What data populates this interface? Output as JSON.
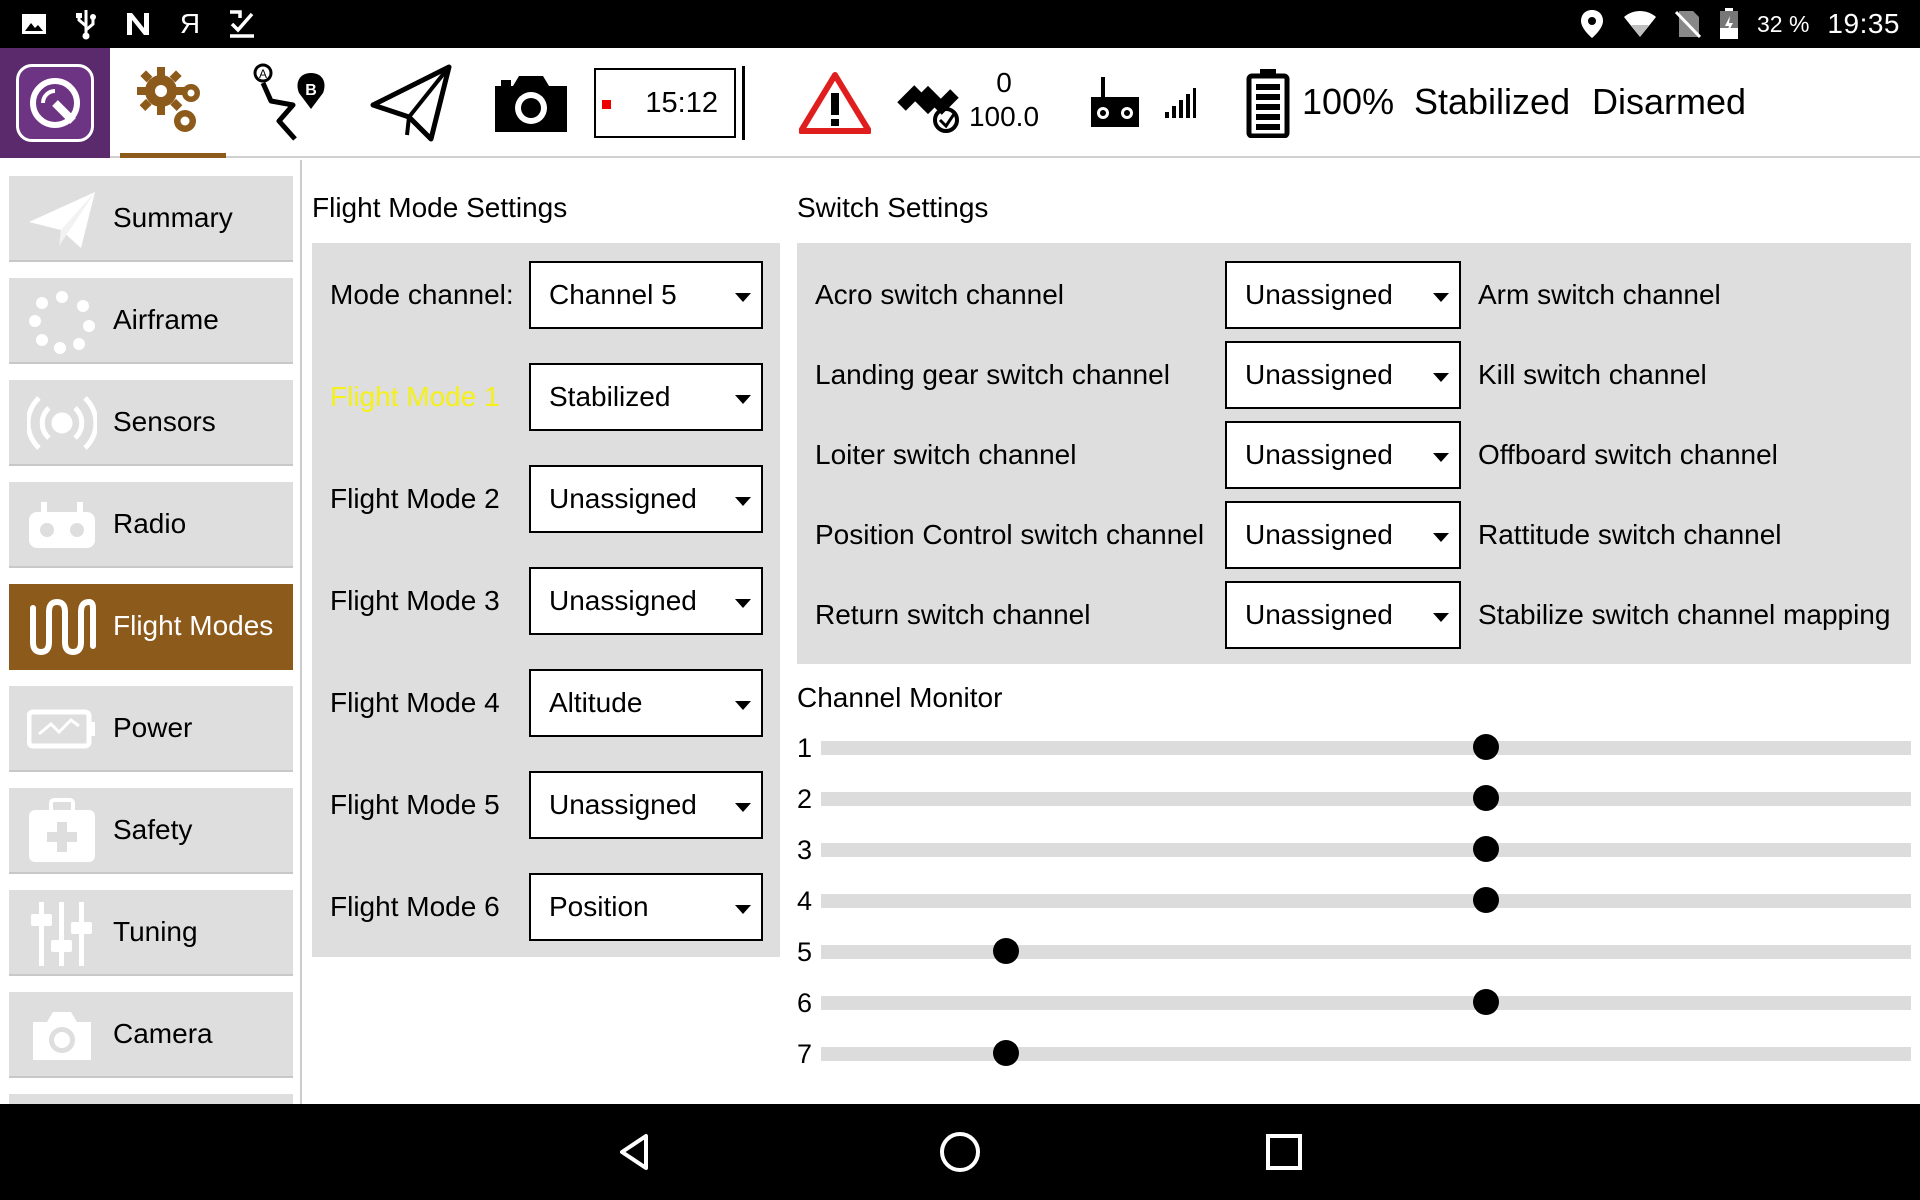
{
  "status_bar": {
    "left_icons": [
      "gallery-icon",
      "usb-icon",
      "nfc-icon",
      "yandex-icon",
      "download-done-icon"
    ],
    "right_icons": [
      "location-icon",
      "wifi-icon",
      "no-sim-icon",
      "battery-charging-icon"
    ],
    "battery_percent": "32 %",
    "time": "19:35"
  },
  "toolbar": {
    "logo": "qgroundcontrol-logo",
    "buttons": [
      "settings-gears-icon",
      "plan-waypoint-icon",
      "fly-paper-plane-icon",
      "camera-icon"
    ],
    "active_button": "settings-gears-icon",
    "timer": "15:12",
    "gps_count": "0",
    "gps_hdop": "100.0",
    "battery": "100%",
    "flight_mode": "Stabilized",
    "arm_state": "Disarmed",
    "colors": {
      "accent": "#8c5a1a",
      "logo_bg": "#5a2a6c",
      "warning": "#e01e1e"
    }
  },
  "nav": {
    "items": [
      {
        "label": "Summary",
        "icon": "paper-plane-icon",
        "active": false
      },
      {
        "label": "Airframe",
        "icon": "airframe-dots-icon",
        "active": false
      },
      {
        "label": "Sensors",
        "icon": "sensor-radio-waves-icon",
        "active": false
      },
      {
        "label": "Radio",
        "icon": "radio-transmitter-icon",
        "active": false
      },
      {
        "label": "Flight Modes",
        "icon": "flight-modes-wave-icon",
        "active": true
      },
      {
        "label": "Power",
        "icon": "power-battery-icon",
        "active": false
      },
      {
        "label": "Safety",
        "icon": "safety-first-aid-icon",
        "active": false
      },
      {
        "label": "Tuning",
        "icon": "tuning-sliders-icon",
        "active": false
      },
      {
        "label": "Camera",
        "icon": "camera-icon",
        "active": false
      }
    ]
  },
  "flight_modes": {
    "title": "Flight Mode Settings",
    "mode_channel_label": "Mode channel:",
    "mode_channel_value": "Channel 5",
    "rows": [
      {
        "label": "Flight Mode 1",
        "value": "Stabilized",
        "highlight": true
      },
      {
        "label": "Flight Mode 2",
        "value": "Unassigned",
        "highlight": false
      },
      {
        "label": "Flight Mode 3",
        "value": "Unassigned",
        "highlight": false
      },
      {
        "label": "Flight Mode 4",
        "value": "Altitude",
        "highlight": false
      },
      {
        "label": "Flight Mode 5",
        "value": "Unassigned",
        "highlight": false
      },
      {
        "label": "Flight Mode 6",
        "value": "Position",
        "highlight": false
      }
    ],
    "highlight_color": "#f5f01a"
  },
  "switch_settings": {
    "title": "Switch Settings",
    "rows": [
      {
        "label": "Acro switch channel",
        "value": "Unassigned",
        "right_label": "Arm switch channel"
      },
      {
        "label": "Landing gear switch channel",
        "value": "Unassigned",
        "right_label": "Kill switch channel"
      },
      {
        "label": "Loiter switch channel",
        "value": "Unassigned",
        "right_label": "Offboard switch channel"
      },
      {
        "label": "Position Control switch channel",
        "value": "Unassigned",
        "right_label": "Rattitude switch channel"
      },
      {
        "label": "Return switch channel",
        "value": "Unassigned",
        "right_label": "Stabilize switch channel mapping"
      }
    ]
  },
  "channel_monitor": {
    "title": "Channel Monitor",
    "channels": [
      {
        "number": "1",
        "level": 0.61
      },
      {
        "number": "2",
        "level": 0.61
      },
      {
        "number": "3",
        "level": 0.61
      },
      {
        "number": "4",
        "level": 0.61
      },
      {
        "number": "5",
        "level": 0.17
      },
      {
        "number": "6",
        "level": 0.61
      },
      {
        "number": "7",
        "level": 0.17
      }
    ]
  },
  "android_nav": {
    "buttons": [
      "back-icon",
      "home-icon",
      "recents-icon"
    ]
  }
}
